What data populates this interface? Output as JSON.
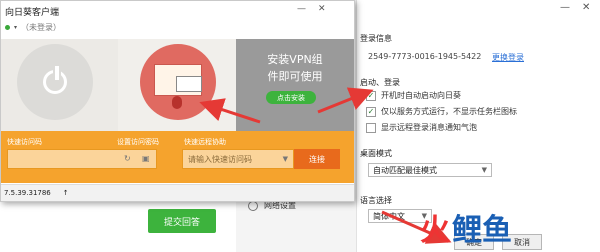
{
  "client": {
    "title": "向日葵客户端",
    "status": "（未登录）",
    "title_controls": [
      "—",
      "✕"
    ],
    "vpn_promo": {
      "title": "安装VPN组\n件即可使用",
      "button": "点击安装"
    },
    "pc_label": "",
    "fast_access": {
      "label": "快速访问码",
      "settings_label": "设置访问密码",
      "value": ""
    },
    "remote_access": {
      "label": "快速远程协助",
      "placeholder": "请输入快速访问码",
      "connect_label": "连接"
    },
    "version": "7.5.39.31786",
    "version_icon": "↑"
  },
  "settings": {
    "submit_label": "提交回答",
    "network_label": "网络设置",
    "window_controls": [
      "—",
      "✕"
    ],
    "login_section": {
      "title": "登录信息",
      "device_code": "2549-7773-0016-1945-5422",
      "change_link": "更换登录"
    },
    "startup_section": {
      "title": "启动、登录",
      "options": [
        {
          "label": "开机时自动启动向日葵",
          "checked": true
        },
        {
          "label": "仅以服务方式运行，不显示任务栏图标",
          "checked": true
        },
        {
          "label": "显示远程登录消息通知气泡",
          "checked": false
        }
      ]
    },
    "desktop_section": {
      "title": "桌面模式",
      "value": "自动匹配最佳模式"
    },
    "language_section": {
      "title": "语言选择",
      "value": "简体中文"
    },
    "ok_label": "确定",
    "cancel_label": "取消"
  },
  "watermark": {
    "part1": "火",
    "part2": "鲤鱼"
  },
  "colors": {
    "accent_green": "#3db33d",
    "accent_orange": "#f5a32d",
    "connect_orange": "#e86a1c",
    "arrow_red": "#e53935"
  }
}
